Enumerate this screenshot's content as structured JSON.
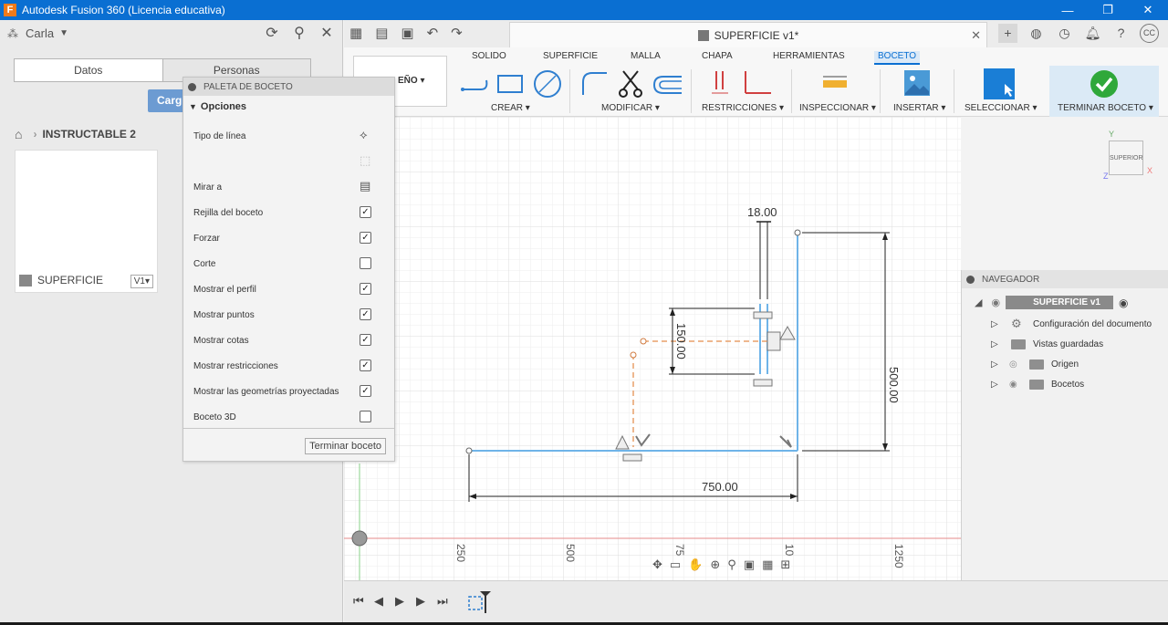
{
  "window": {
    "title": "Autodesk Fusion 360 (Licencia educativa)",
    "minimize": "—",
    "restore": "❐",
    "close": "✕"
  },
  "data_panel": {
    "user": "Carla",
    "tabs": [
      "Datos",
      "Personas"
    ],
    "upload_button": "Carg",
    "breadcrumb": "INSTRUCTABLE 2",
    "card": {
      "name": "SUPERFICIE",
      "version": "V1▾"
    }
  },
  "palette": {
    "title": "PALETA DE BOCETO",
    "section": "Opciones",
    "rows": [
      {
        "label": "Tipo de línea",
        "control": "icon"
      },
      {
        "label": "",
        "control": "icon"
      },
      {
        "label": "Mirar a",
        "control": "icon"
      },
      {
        "label": "Rejilla del boceto",
        "control": "checkbox",
        "checked": true
      },
      {
        "label": "Forzar",
        "control": "checkbox",
        "checked": true
      },
      {
        "label": "Corte",
        "control": "checkbox",
        "checked": false
      },
      {
        "label": "Mostrar el perfil",
        "control": "checkbox",
        "checked": true
      },
      {
        "label": "Mostrar puntos",
        "control": "checkbox",
        "checked": true
      },
      {
        "label": "Mostrar cotas",
        "control": "checkbox",
        "checked": true
      },
      {
        "label": "Mostrar restricciones",
        "control": "checkbox",
        "checked": true
      },
      {
        "label": "Mostrar las geometrías proyectadas",
        "control": "checkbox",
        "checked": true
      },
      {
        "label": "Boceto 3D",
        "control": "checkbox",
        "checked": false
      }
    ],
    "finish_button": "Terminar boceto"
  },
  "document_tab": {
    "title": "SUPERFICIE v1*"
  },
  "ribbon": {
    "workspace": "EÑO ▾",
    "tabs": [
      "SOLIDO",
      "SUPERFICIE",
      "MALLA",
      "CHAPA",
      "HERRAMIENTAS",
      "BOCETO"
    ],
    "active_tab": "BOCETO",
    "groups": [
      "CREAR ▾",
      "MODIFICAR ▾",
      "RESTRICCIONES ▾",
      "INSPECCIONAR ▾",
      "INSERTAR ▾",
      "SELECCIONAR ▾",
      "TERMINAR BOCETO ▾"
    ]
  },
  "sketch": {
    "dims": [
      "18.00",
      "150.00",
      "500.00",
      "750.00"
    ],
    "axis_ticks": [
      "250",
      "500",
      "75",
      "10",
      "1250"
    ]
  },
  "viewcube": {
    "face": "SUPERIOR",
    "x": "X",
    "y": "Y",
    "z": "Z"
  },
  "navigator": {
    "title": "NAVEGADOR",
    "root": "SUPERFICIE v1",
    "items": [
      "Configuración del documento",
      "Vistas guardadas",
      "Origen",
      "Bocetos"
    ]
  },
  "colors": {
    "accent": "#0a6fd2",
    "sketch_line": "#6fb4e8",
    "construction": "#e8a06a"
  }
}
